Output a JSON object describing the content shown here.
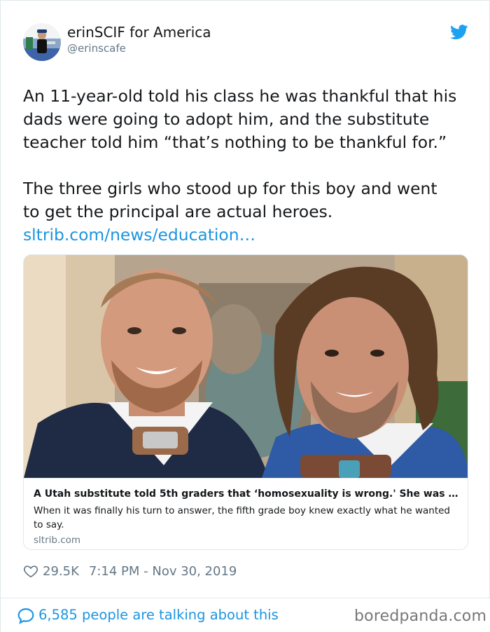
{
  "tweet": {
    "author": {
      "display_name": "erinSCIF for America",
      "handle": "@erinscafe",
      "avatar_icon": "profile-photo"
    },
    "logo_icon": "twitter-bird-icon",
    "text_lines": [
      "An 11-year-old told his class he was thankful that his",
      "dads were going to adopt him, and the substitute",
      "teacher told him “that’s nothing to be thankful for.”"
    ],
    "text_lines_2": [
      "The three girls who stood up for this boy and went",
      "to get the principal are actual heroes."
    ],
    "link_text": "sltrib.com/news/education…",
    "card": {
      "title": "A Utah substitute told 5th graders that ‘homosexuality is wrong.' She was ...",
      "description": "When it was finally his turn to answer, the fifth grade boy knew exactly what he wanted to say.",
      "domain": "sltrib.com"
    },
    "likes": "29.5K",
    "timestamp": "7:14 PM - Nov 30, 2019",
    "talking": "6,585 people are talking about this"
  },
  "watermark": "boredpanda.com",
  "colors": {
    "link": "#1b95e0",
    "secondary_text": "#657786",
    "border": "#e1e8ed"
  }
}
